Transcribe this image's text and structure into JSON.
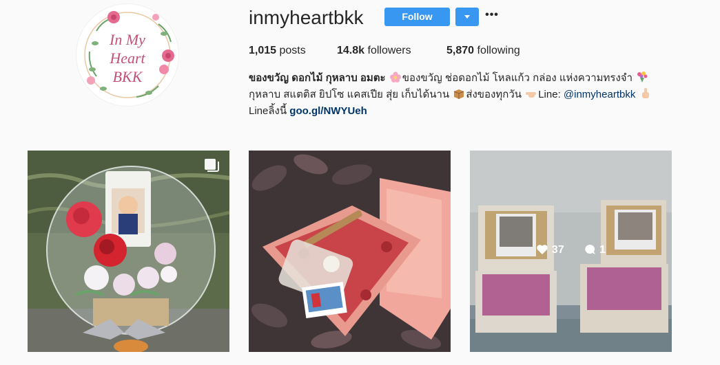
{
  "profile": {
    "username": "inmyheartbkk",
    "avatar_text": [
      "In My",
      "Heart",
      "BKK"
    ],
    "follow_label": "Follow",
    "more_label": "•••"
  },
  "stats": {
    "posts_count": "1,015",
    "posts_label": "posts",
    "followers_count": "14.8k",
    "followers_label": "followers",
    "following_count": "5,870",
    "following_label": "following"
  },
  "bio": {
    "name": "ของขวัญ ดอกไม้ กุหลาบ อมตะ",
    "line1_rest": "ของขวัญ ช่อดอกไม้ โหลแก้ว กล่อง แห่งความทรงจำ",
    "line2": "กุหลาบ สแตติส ยิปโซ แคสเปีย สุ่ย เก็บได้นาน",
    "line2_b": "ส่งของทุกวัน",
    "line2_c": "Line: ",
    "line_handle": "@inmyheartbkk",
    "line3_prefix": "Lineลิ้งนี้ ",
    "link": "goo.gl/NWYUeh"
  },
  "icons": [
    "flower-icon",
    "bouquet-icon",
    "package-icon",
    "pointing-hand-icon",
    "heart-icon",
    "comment-icon",
    "multiple-images-icon"
  ],
  "posts": [
    {
      "type": "carousel"
    },
    {
      "type": "image"
    },
    {
      "type": "image",
      "likes": "37",
      "comments": "1"
    }
  ],
  "colors": {
    "accent": "#3897f0",
    "link": "#003569",
    "text": "#262626"
  }
}
